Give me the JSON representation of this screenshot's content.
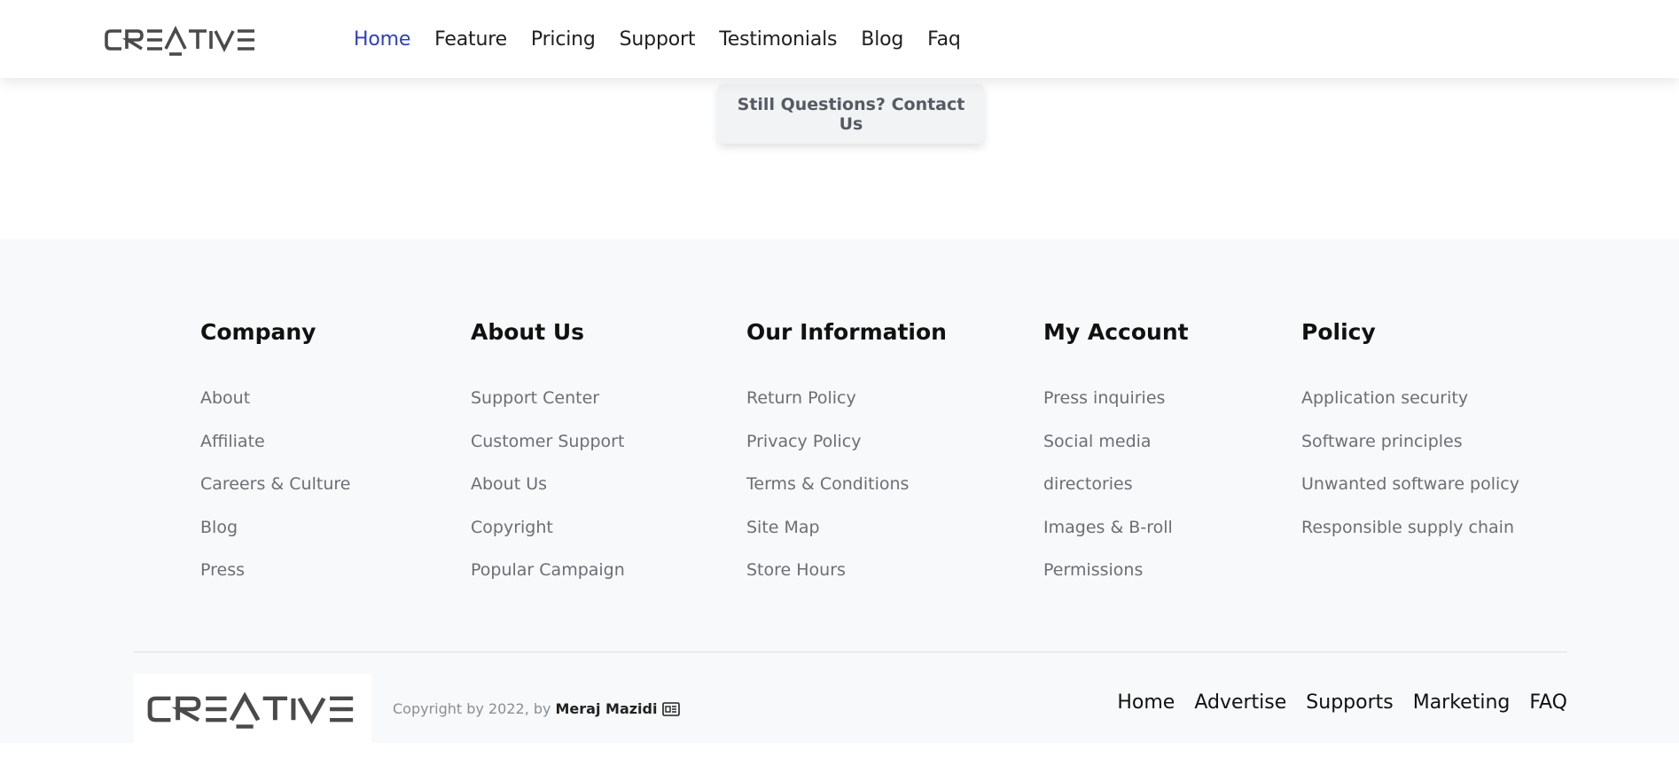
{
  "brand": {
    "logo_text": "CREATIVE"
  },
  "nav": {
    "items": [
      {
        "label": "Home",
        "active": true
      },
      {
        "label": "Feature"
      },
      {
        "label": "Pricing"
      },
      {
        "label": "Support"
      },
      {
        "label": "Testimonials"
      },
      {
        "label": "Blog"
      },
      {
        "label": "Faq"
      }
    ]
  },
  "cta": {
    "label": "Still Questions? Contact Us"
  },
  "footer": {
    "columns": [
      {
        "title": "Company",
        "links": [
          "About",
          "Affiliate",
          "Careers & Culture",
          "Blog",
          "Press"
        ]
      },
      {
        "title": "About Us",
        "links": [
          "Support Center",
          "Customer Support",
          "About Us",
          "Copyright",
          "Popular Campaign"
        ]
      },
      {
        "title": "Our Information",
        "links": [
          "Return Policy",
          "Privacy Policy",
          "Terms & Conditions",
          "Site Map",
          "Store Hours"
        ]
      },
      {
        "title": "My Account",
        "links": [
          "Press inquiries",
          "Social media",
          "directories",
          "Images & B-roll",
          "Permissions"
        ]
      },
      {
        "title": "Policy",
        "links": [
          "Application security",
          "Software principles",
          "Unwanted software policy",
          "Responsible supply chain"
        ]
      }
    ],
    "copyright_prefix": "Copyright by 2022, by",
    "copyright_author": "Meraj Mazidi",
    "copyright_icon": "id-card-icon",
    "bottom_links": [
      "Home",
      "Advertise",
      "Supports",
      "Marketing",
      "FAQ"
    ]
  },
  "colors": {
    "accent": "#2e3fb8",
    "logo": "#4a4a4a",
    "footer_bg": "#f8f9fa",
    "muted_text": "#6b6f75"
  }
}
